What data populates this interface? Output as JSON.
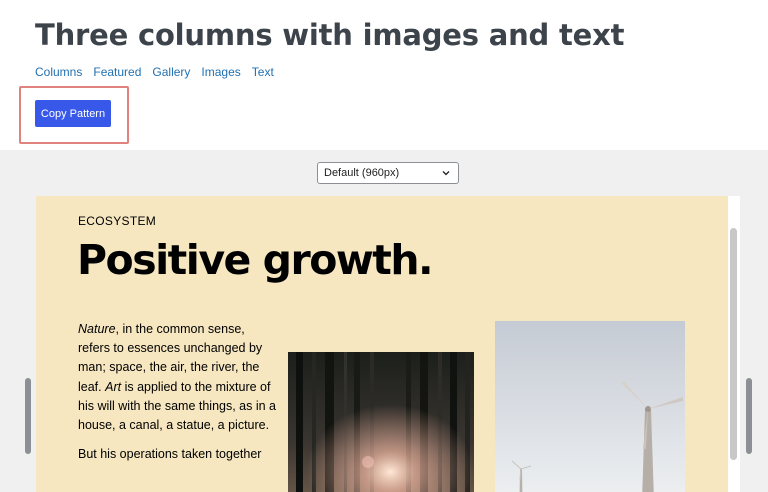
{
  "header": {
    "title": "Three columns with images and text",
    "tags": [
      "Columns",
      "Featured",
      "Gallery",
      "Images",
      "Text"
    ],
    "copy_button": "Copy Pattern"
  },
  "preview": {
    "viewport_selected": "Default (960px)",
    "eyebrow": "ECOSYSTEM",
    "headline": "Positive growth.",
    "para1_italic1": "Nature",
    "para1_part1": ", in the common sense, refers to essences unchanged by man; space, the air, the river, the leaf. ",
    "para1_italic2": "Art",
    "para1_part2": " is applied to the mixture of his will with the same things, as in a house, a canal, a statue, a picture.",
    "para2": "But his operations taken together"
  },
  "colors": {
    "accent": "#3858e9",
    "link": "#2271b1",
    "pattern_bg": "#f6e7c1",
    "preview_bg": "#f0f0f1"
  }
}
